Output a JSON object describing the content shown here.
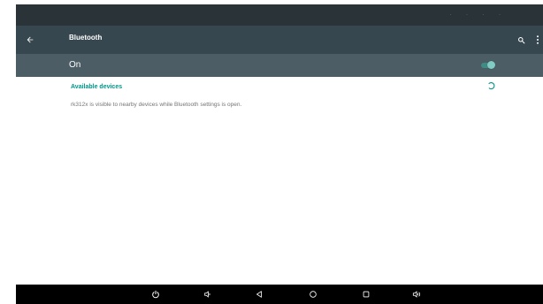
{
  "app": {
    "title": "Bluetooth"
  },
  "toolbar": {
    "back_icon": "arrow-back-icon",
    "search_icon": "search-icon",
    "overflow_icon": "more-vert-icon"
  },
  "master_switch": {
    "label": "On",
    "checked": true
  },
  "available_devices": {
    "header": "Available devices",
    "scanning_icon": "progress-spinner-icon"
  },
  "visibility_summary": "rk312x is visible to nearby devices while Bluetooth settings is open.",
  "nav_bar": {
    "buttons": [
      {
        "name": "power-button",
        "icon": "power-icon"
      },
      {
        "name": "volume-down-button",
        "icon": "volume-down-icon"
      },
      {
        "name": "back-nav-button",
        "icon": "triangle-back-icon"
      },
      {
        "name": "home-button",
        "icon": "circle-home-icon"
      },
      {
        "name": "recents-button",
        "icon": "square-recents-icon"
      },
      {
        "name": "volume-up-button",
        "icon": "volume-up-icon"
      }
    ]
  },
  "colors": {
    "status_bar": "#2a3338",
    "toolbar": "#37474f",
    "switch_bar": "#4c5d66",
    "accent": "#009688",
    "switch_track": "#3d8c85",
    "switch_thumb": "#80cbc4",
    "nav_bar": "#000000"
  }
}
